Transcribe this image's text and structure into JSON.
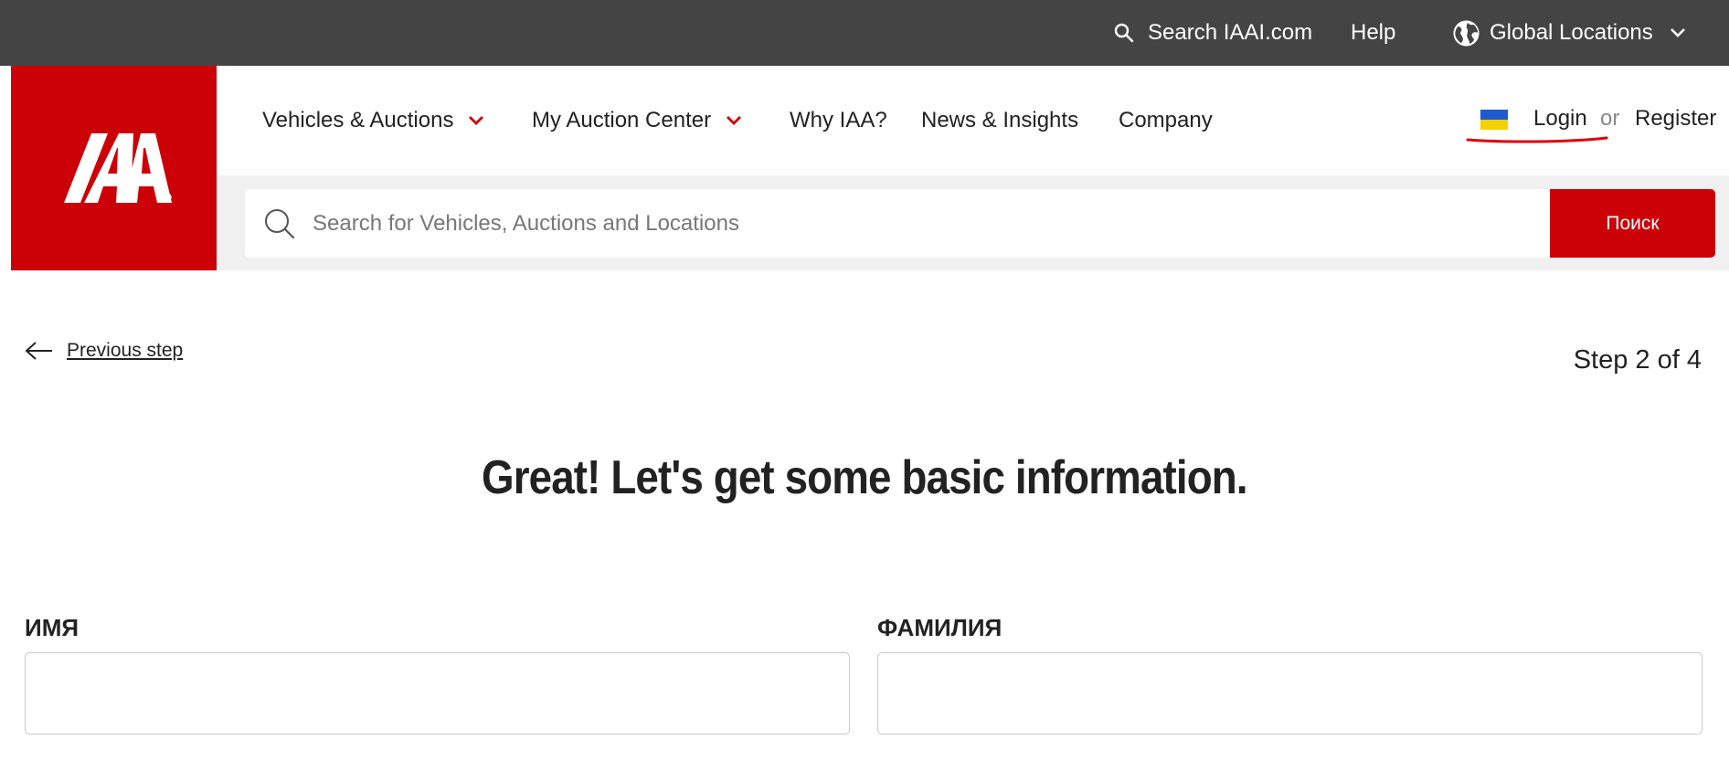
{
  "topbar": {
    "search_label": "Search IAAI.com",
    "help_label": "Help",
    "global_label": "Global Locations"
  },
  "logo": {
    "text": "IAA"
  },
  "nav": {
    "items": [
      {
        "label": "Vehicles & Auctions",
        "has_dropdown": true
      },
      {
        "label": "My Auction Center",
        "has_dropdown": true
      },
      {
        "label": "Why IAA?",
        "has_dropdown": false
      },
      {
        "label": "News & Insights",
        "has_dropdown": false
      },
      {
        "label": "Company",
        "has_dropdown": false
      }
    ],
    "login_label": "Login",
    "or_label": "or",
    "register_label": "Register",
    "flag": "ukraine-flag-icon"
  },
  "search": {
    "placeholder": "Search for Vehicles, Auctions and Locations",
    "value": "",
    "button_label": "Поиск"
  },
  "wizard": {
    "previous_label": "Previous step",
    "step_label": "Step 2 of 4",
    "heading": "Great! Let's get some basic information.",
    "fields": [
      {
        "label": "ИМЯ",
        "value": ""
      },
      {
        "label": "ФАМИЛИЯ",
        "value": ""
      }
    ]
  },
  "colors": {
    "brand_red": "#cc0007",
    "topbar_bg": "#444444",
    "search_band_bg": "#f0f0f0",
    "flag_blue": "#1f5bd0",
    "flag_yellow": "#f5d000"
  }
}
